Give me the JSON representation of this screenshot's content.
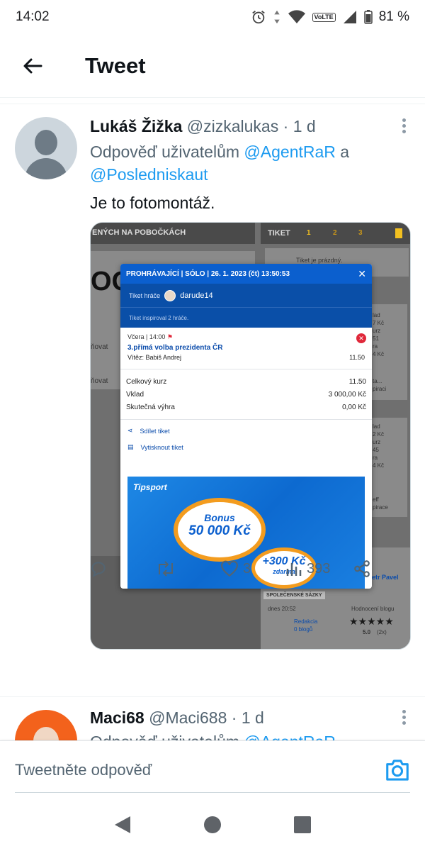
{
  "status_bar": {
    "time": "14:02",
    "battery": "81 %",
    "network": "VoLTE"
  },
  "header": {
    "title": "Tweet"
  },
  "tweet": {
    "author_name": "Lukáš Žižka",
    "handle": "@zizkalukas",
    "sep": "·",
    "age": "1 d",
    "reply_prefix": "Odpověď uživatelům",
    "reply_to_1": "@AgentRaR",
    "reply_and": "a",
    "reply_to_2": "@Posledniskaut",
    "text": "Je to fotomontáž.",
    "stats": {
      "likes": "3",
      "views": "393"
    }
  },
  "media": {
    "bg_left_header": "ENÝCH NA POBOČKÁCH",
    "bg_left_text": "OOI",
    "bg_left_a": "ňovat",
    "bg_left_b": "ňovat",
    "bg_tiket_tab": "TIKET",
    "bg_tiket_nums": [
      "1",
      "2",
      "3"
    ],
    "bg_tiket_empty": "Tiket je prázdný.",
    "bg_right_col": [
      "lad",
      "7 Kč",
      "urz",
      "51",
      "ra",
      "4 Kč"
    ],
    "bg_right_col2": [
      "lad",
      "2 Kč",
      "urz",
      "45",
      "ra",
      "4 Kč"
    ],
    "bg_right_misc": [
      "ta...",
      "piraci",
      "eff",
      "pirace"
    ],
    "bg_bottom": {
      "name": "etr Pavel",
      "tag": "SPOLEČENSKÉ SÁZKY",
      "date": "dnes 20:52",
      "rating_label": "Hodnocení blogu",
      "author": "Redakcia",
      "blogs": "0 blogů",
      "stars": "★★★★★",
      "score": "5.0",
      "count": "(2x)"
    },
    "modal": {
      "title": "PROHRÁVAJÍCÍ | SÓLO | 26. 1. 2023 (čt) 13:50:53",
      "tiket_label": "Tiket hráče",
      "player": "darude14",
      "inspired": "Tiket inspiroval 2 hráče.",
      "when": "Včera | 14:00",
      "event": "3.přímá volba prezidenta ČR",
      "winner": "Vítěz: Babiš Andrej",
      "odds": "11.50",
      "rows": [
        {
          "k": "Celkový kurz",
          "v": "11.50"
        },
        {
          "k": "Vklad",
          "v": "3 000,00 Kč"
        },
        {
          "k": "Skutečná výhra",
          "v": "0,00 Kč"
        }
      ],
      "share": "Sdílet tiket",
      "print": "Vytisknout tiket",
      "banner_logo": "Tipsport",
      "bonus": "Bonus",
      "bonus_amount": "50 000 Kč",
      "extra": "+300 Kč",
      "extra_sub": "zdarma"
    }
  },
  "tweet2": {
    "author_name": "Maci68",
    "handle": "@Maci688",
    "sep": "·",
    "age": "1 d",
    "reply_prefix": "Odpověď uživatelům",
    "reply_to": "@AgentRaR"
  },
  "reply": {
    "placeholder": "Tweetněte odpověď"
  },
  "colors": {
    "accent": "#1d9bf0",
    "muted": "#536471",
    "tipsport_blue": "#0b5fce",
    "bonus_orange": "#f39c1f"
  }
}
